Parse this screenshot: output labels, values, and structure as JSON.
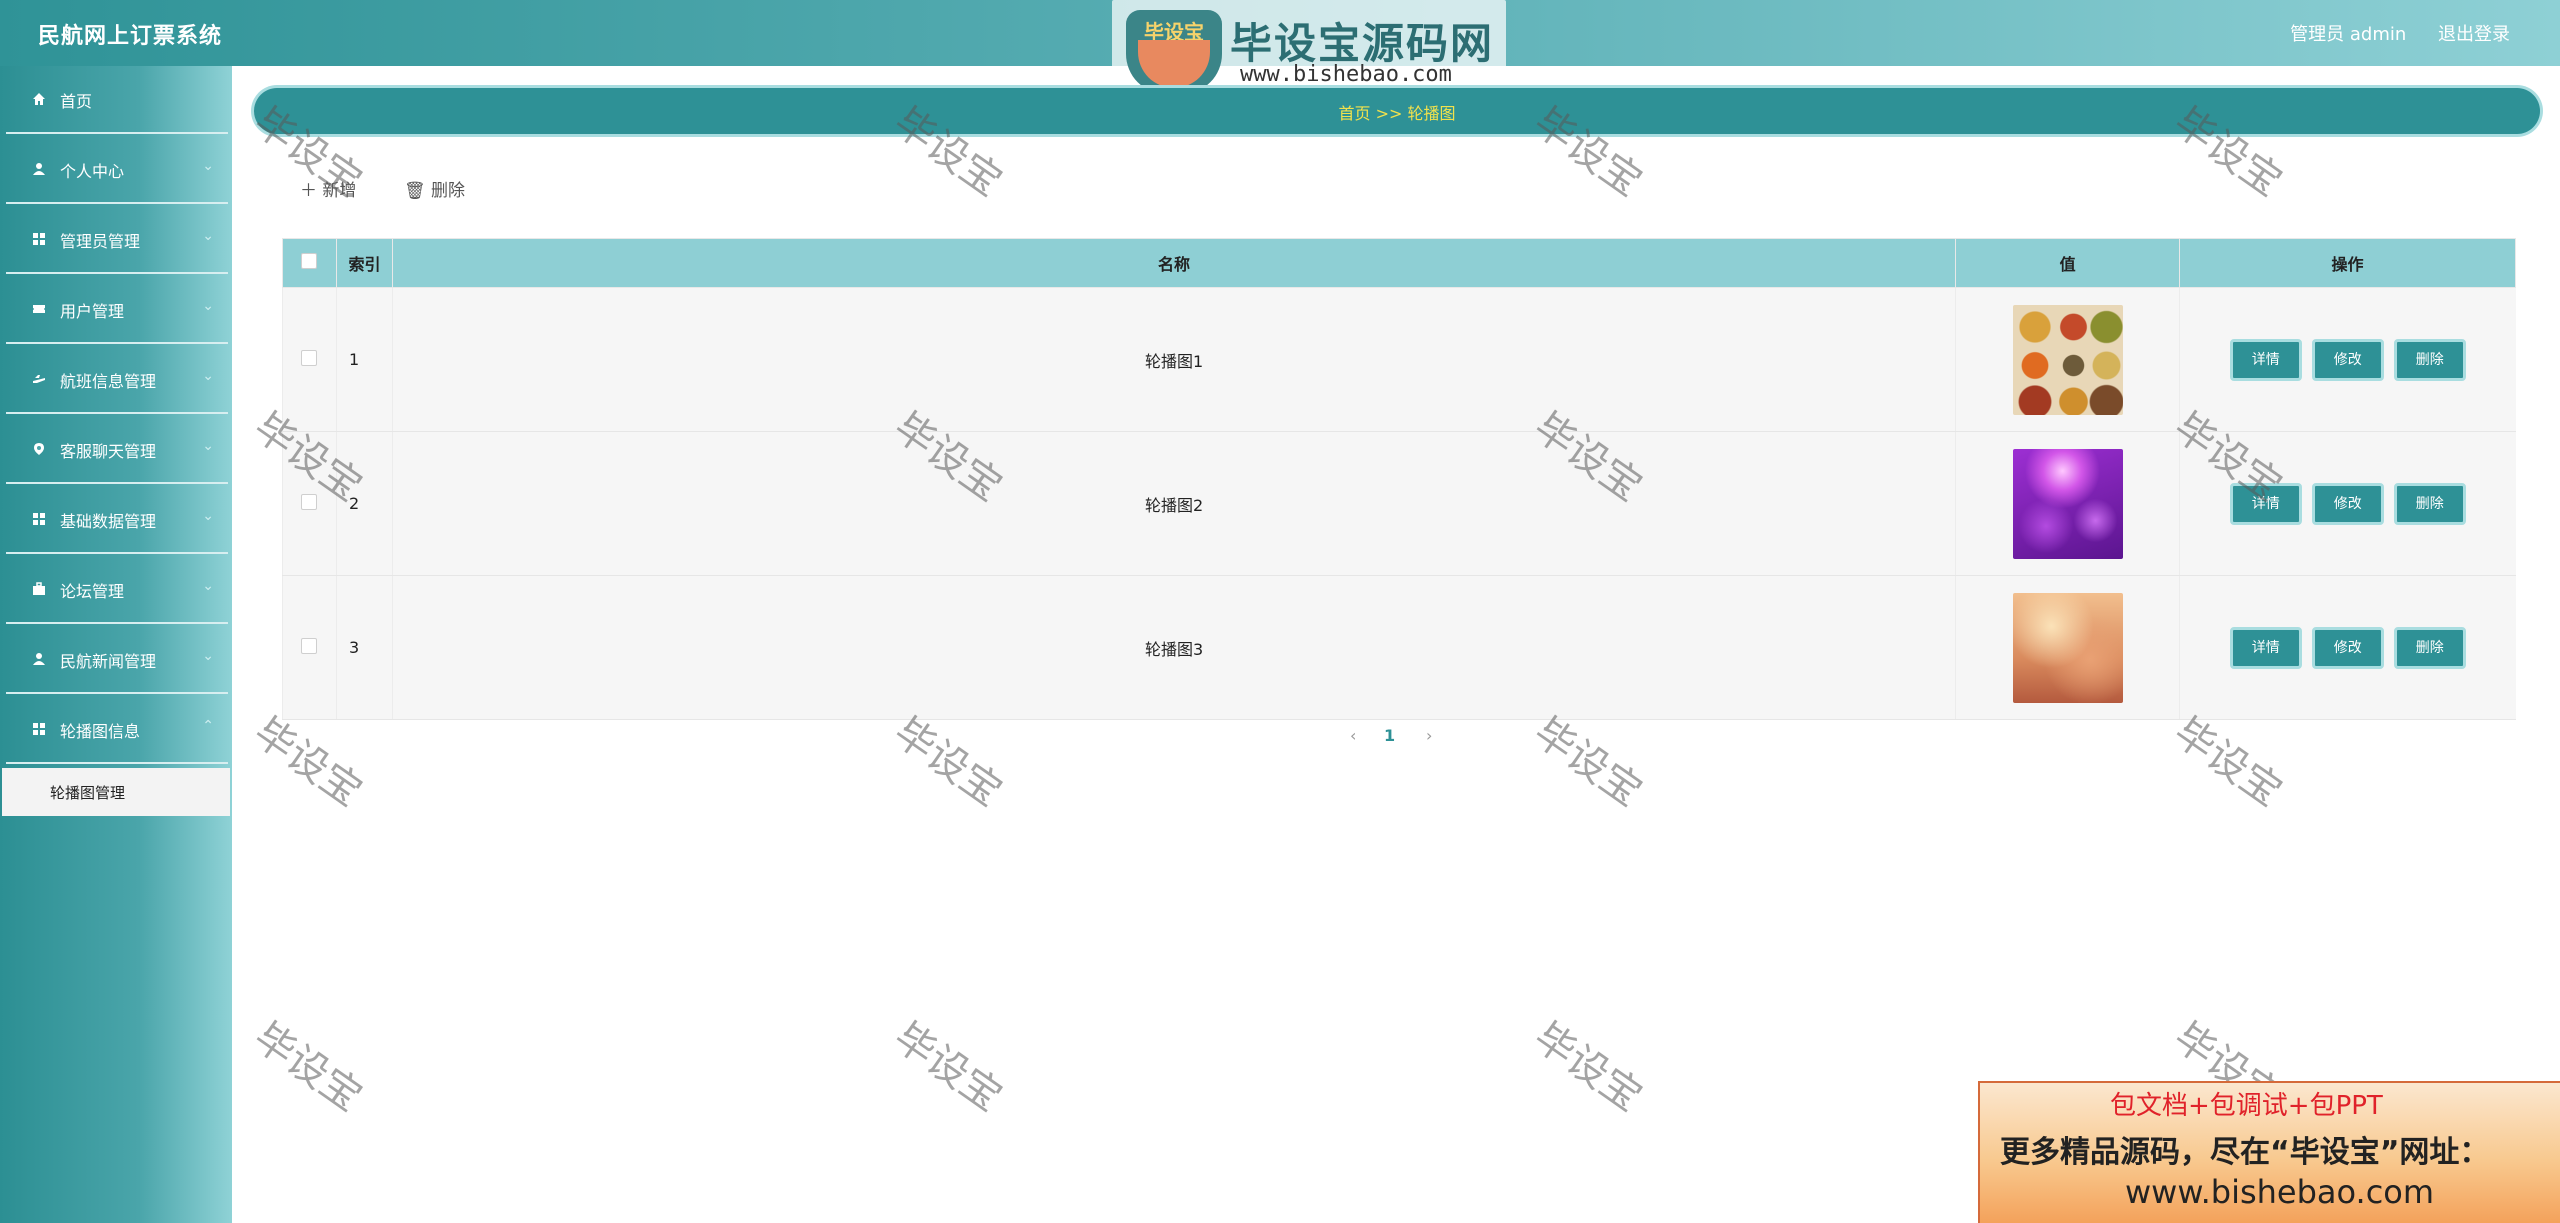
{
  "header": {
    "app_title": "民航网上订票系统",
    "admin_label": "管理员 admin",
    "logout_label": "退出登录",
    "logo_badge_text": "毕设宝",
    "logo_title": "毕设宝源码网",
    "logo_url": "www.bishebao.com"
  },
  "sidebar": {
    "items": [
      {
        "label": "首页",
        "icon": "home-icon"
      },
      {
        "label": "个人中心",
        "icon": "user-icon"
      },
      {
        "label": "管理员管理",
        "icon": "grid-icon"
      },
      {
        "label": "用户管理",
        "icon": "ticket-icon"
      },
      {
        "label": "航班信息管理",
        "icon": "plane-icon"
      },
      {
        "label": "客服聊天管理",
        "icon": "location-icon"
      },
      {
        "label": "基础数据管理",
        "icon": "grid-icon"
      },
      {
        "label": "论坛管理",
        "icon": "briefcase-icon"
      },
      {
        "label": "民航新闻管理",
        "icon": "user-icon"
      },
      {
        "label": "轮播图信息",
        "icon": "grid-icon"
      }
    ],
    "sub_item": "轮播图管理"
  },
  "breadcrumb": {
    "text": "首页  >>  轮播图"
  },
  "toolbar": {
    "add_label": "＋ 新增",
    "delete_label": "🗑 删除"
  },
  "table": {
    "columns": [
      "索引",
      "名称",
      "值",
      "操作"
    ],
    "rows": [
      {
        "index": "1",
        "name": "轮播图1",
        "image": "spices-thumbnail"
      },
      {
        "index": "2",
        "name": "轮播图2",
        "image": "purple-bokeh-thumbnail"
      },
      {
        "index": "3",
        "name": "轮播图3",
        "image": "warm-blur-thumbnail"
      }
    ],
    "actions": [
      "详情",
      "修改",
      "删除"
    ]
  },
  "pagination": {
    "prev": "‹",
    "current": "1",
    "next": "›"
  },
  "watermark": "毕设宝",
  "promo": {
    "line1": "包文档+包调试+包PPT",
    "line2": "更多精品源码，尽在“毕设宝”网址：",
    "line3": "www.bishebao.com"
  },
  "colors": {
    "primary": "#2e9196",
    "header_end": "#8ed0d5",
    "table_header": "#8ecfd4",
    "breadcrumb_text": "#f2e24c"
  }
}
